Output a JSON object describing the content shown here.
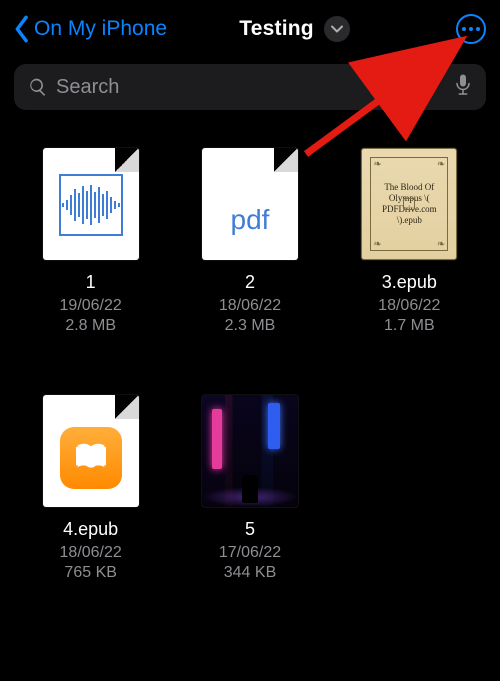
{
  "nav": {
    "back_label": "On My iPhone",
    "title": "Testing"
  },
  "search": {
    "placeholder": "Search"
  },
  "files": [
    {
      "name": "1",
      "date": "19/06/22",
      "size": "2.8 MB"
    },
    {
      "name": "2",
      "date": "18/06/22",
      "size": "2.3 MB"
    },
    {
      "name": "3.epub",
      "date": "18/06/22",
      "size": "1.7 MB",
      "cover_text": "The Blood Of Olympus \\( PDFDrive.com \\).epub"
    },
    {
      "name": "4.epub",
      "date": "18/06/22",
      "size": "765 KB"
    },
    {
      "name": "5",
      "date": "17/06/22",
      "size": "344 KB"
    }
  ],
  "icons": {
    "pdf_label": "pdf"
  }
}
